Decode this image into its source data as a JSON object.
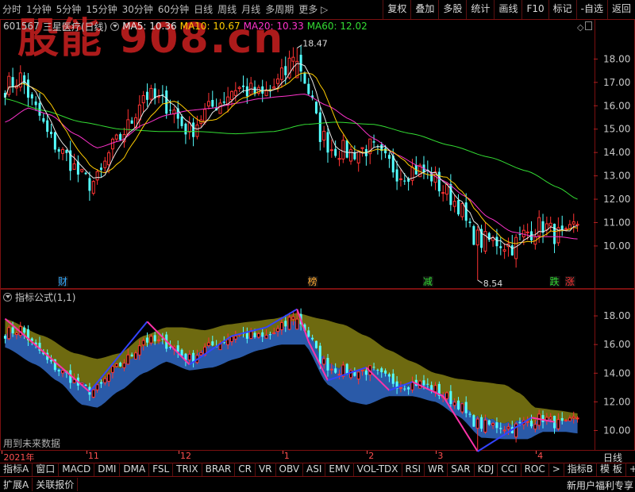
{
  "toolbar": {
    "periods": [
      "分时",
      "1分钟",
      "5分钟",
      "15分钟",
      "30分钟",
      "60分钟",
      "日线",
      "周线",
      "月线",
      "多周期",
      "更多 ▷"
    ],
    "tools": [
      "复权",
      "叠加",
      "多股",
      "统计",
      "画线",
      "F10",
      "标记",
      "-自选",
      "返回"
    ]
  },
  "stock": {
    "code": "601567",
    "name": "三星医疗(日线)"
  },
  "ma_readout": {
    "ma5": "MA5: 10.36",
    "ma10": "MA10: 10.67",
    "ma20": "MA20: 10.33",
    "ma60": "MA60: 12.02"
  },
  "watermark": "股能 908.cn",
  "indicator": {
    "title": "指标公式(1,1)",
    "future_note": "用到未来数据"
  },
  "date_axis": [
    {
      "label": "2021年",
      "index": 0
    },
    {
      "label": "11",
      "index": 22
    },
    {
      "label": "12",
      "index": 46
    },
    {
      "label": "1",
      "index": 73
    },
    {
      "label": "2",
      "index": 95
    },
    {
      "label": "3",
      "index": 113
    },
    {
      "label": "4",
      "index": 139
    }
  ],
  "zoom_label": "日线",
  "indicator_tabs": [
    "指标A",
    "窗口",
    "MACD",
    "DMI",
    "DMA",
    "FSL",
    "TRIX",
    "BRAR",
    "CR",
    "VR",
    "OBV",
    "ASI",
    "EMV",
    "VOL-TDX",
    "RSI",
    "WR",
    "SAR",
    "KDJ",
    "CCI",
    "ROC",
    ">",
    "指标B",
    "模 板",
    "+",
    "-"
  ],
  "bottom": {
    "left": [
      "扩展A",
      "关联报价"
    ],
    "promo": "新用户福利专享"
  },
  "colors": {
    "up": "#ff3333",
    "down": "#54ffff",
    "frame": "#7a1010",
    "ma5": "#e8e8e8",
    "ma10": "#ffcc00",
    "ma20": "#ff33cc",
    "ma60": "#33dd33",
    "band_upper": "#6e6a10",
    "band_lower": "#2a5aa8"
  },
  "chart_data": [
    {
      "type": "candlestick",
      "name": "main",
      "yticks": [
        10.0,
        11.0,
        12.0,
        13.0,
        14.0,
        15.0,
        16.0,
        17.0,
        18.0
      ],
      "ylim": [
        8.3,
        19.1
      ],
      "n_bars": 150,
      "ohlc_key": [
        [
          0,
          16.8
        ],
        [
          4,
          17.2
        ],
        [
          8,
          15.8
        ],
        [
          12,
          14.5
        ],
        [
          16,
          13.8
        ],
        [
          20,
          12.9
        ],
        [
          22,
          12.7
        ],
        [
          24,
          12.8
        ],
        [
          28,
          14.2
        ],
        [
          32,
          15.1
        ],
        [
          36,
          16.5
        ],
        [
          40,
          16.2
        ],
        [
          43,
          16.0
        ],
        [
          46,
          15.2
        ],
        [
          48,
          14.9
        ],
        [
          52,
          15.7
        ],
        [
          56,
          16.2
        ],
        [
          60,
          16.8
        ],
        [
          64,
          16.6
        ],
        [
          67,
          16.4
        ],
        [
          70,
          16.8
        ],
        [
          73,
          17.4
        ],
        [
          75,
          18.3
        ],
        [
          77,
          17.6
        ],
        [
          79,
          16.6
        ],
        [
          82,
          14.8
        ],
        [
          85,
          14.2
        ],
        [
          90,
          14.0
        ],
        [
          95,
          14.2
        ],
        [
          99,
          13.6
        ],
        [
          103,
          13.1
        ],
        [
          107,
          13.3
        ],
        [
          111,
          13.0
        ],
        [
          114,
          12.4
        ],
        [
          118,
          11.8
        ],
        [
          121,
          10.6
        ],
        [
          124,
          10.2
        ],
        [
          128,
          10.2
        ],
        [
          132,
          10.0
        ],
        [
          136,
          10.6
        ],
        [
          140,
          10.9
        ],
        [
          143,
          10.5
        ],
        [
          146,
          10.3
        ],
        [
          149,
          11.0
        ]
      ],
      "ma20_key": [
        [
          0,
          15.3
        ],
        [
          6,
          15.9
        ],
        [
          12,
          15.6
        ],
        [
          18,
          14.8
        ],
        [
          24,
          14.2
        ],
        [
          30,
          14.5
        ],
        [
          36,
          15.2
        ],
        [
          42,
          15.6
        ],
        [
          48,
          15.8
        ],
        [
          54,
          15.9
        ],
        [
          60,
          16.1
        ],
        [
          66,
          16.3
        ],
        [
          72,
          16.4
        ],
        [
          78,
          16.5
        ],
        [
          84,
          16.0
        ],
        [
          90,
          15.4
        ],
        [
          96,
          14.6
        ],
        [
          102,
          13.9
        ],
        [
          108,
          13.4
        ],
        [
          114,
          12.8
        ],
        [
          120,
          12.1
        ],
        [
          126,
          11.2
        ],
        [
          132,
          10.6
        ],
        [
          138,
          10.4
        ],
        [
          144,
          10.4
        ],
        [
          149,
          10.3
        ]
      ],
      "ma60_key": [
        [
          0,
          16.3
        ],
        [
          10,
          15.8
        ],
        [
          20,
          15.3
        ],
        [
          30,
          15.0
        ],
        [
          40,
          14.9
        ],
        [
          50,
          14.9
        ],
        [
          60,
          14.8
        ],
        [
          70,
          14.9
        ],
        [
          78,
          15.2
        ],
        [
          86,
          15.3
        ],
        [
          96,
          15.2
        ],
        [
          106,
          14.8
        ],
        [
          116,
          14.3
        ],
        [
          126,
          13.8
        ],
        [
          136,
          13.2
        ],
        [
          144,
          12.5
        ],
        [
          149,
          12.0
        ]
      ],
      "annotations": [
        {
          "text": "18.47",
          "index": 76,
          "value": 18.47
        },
        {
          "text": "8.54",
          "index": 123,
          "value": 8.54
        }
      ],
      "event_markers": [
        {
          "text": "财",
          "index": 15,
          "color": "#33aaff"
        },
        {
          "text": "榜",
          "index": 80,
          "color": "#ffaa33"
        },
        {
          "text": "减",
          "index": 110,
          "color": "#33dd33"
        },
        {
          "text": "跌",
          "index": 143,
          "color": "#33dd33"
        },
        {
          "text": "涨",
          "index": 147,
          "color": "#ff3333"
        }
      ]
    },
    {
      "type": "band_candlestick",
      "name": "indicator",
      "yticks": [
        10.0,
        12.0,
        14.0,
        16.0,
        18.0
      ],
      "ylim": [
        8.7,
        19.0
      ],
      "upper_key": [
        [
          0,
          17.8
        ],
        [
          10,
          16.6
        ],
        [
          18,
          15.4
        ],
        [
          24,
          15.0
        ],
        [
          30,
          15.4
        ],
        [
          36,
          16.6
        ],
        [
          42,
          17.2
        ],
        [
          46,
          17.2
        ],
        [
          52,
          17.0
        ],
        [
          58,
          17.4
        ],
        [
          64,
          17.6
        ],
        [
          70,
          17.8
        ],
        [
          76,
          18.2
        ],
        [
          82,
          17.8
        ],
        [
          88,
          17.4
        ],
        [
          94,
          16.6
        ],
        [
          100,
          15.6
        ],
        [
          106,
          14.8
        ],
        [
          112,
          14.0
        ],
        [
          118,
          13.6
        ],
        [
          124,
          13.4
        ],
        [
          130,
          13.2
        ],
        [
          134,
          12.6
        ],
        [
          138,
          11.6
        ],
        [
          144,
          11.4
        ],
        [
          149,
          11.2
        ]
      ],
      "lower_key": [
        [
          0,
          15.8
        ],
        [
          8,
          14.6
        ],
        [
          14,
          13.4
        ],
        [
          20,
          11.8
        ],
        [
          24,
          11.6
        ],
        [
          30,
          12.8
        ],
        [
          36,
          14.0
        ],
        [
          42,
          14.8
        ],
        [
          48,
          14.2
        ],
        [
          54,
          14.4
        ],
        [
          60,
          15.0
        ],
        [
          66,
          15.6
        ],
        [
          72,
          16.0
        ],
        [
          78,
          16.0
        ],
        [
          84,
          13.2
        ],
        [
          90,
          12.0
        ],
        [
          94,
          11.8
        ],
        [
          100,
          12.4
        ],
        [
          106,
          12.4
        ],
        [
          112,
          12.0
        ],
        [
          118,
          11.0
        ],
        [
          124,
          9.5
        ],
        [
          130,
          9.4
        ],
        [
          136,
          9.4
        ],
        [
          140,
          9.9
        ],
        [
          146,
          9.9
        ],
        [
          149,
          9.8
        ]
      ],
      "zigzag": [
        [
          0,
          17.8
        ],
        [
          22,
          12.7
        ],
        [
          37,
          17.6
        ],
        [
          48,
          14.6
        ],
        [
          59,
          16.6
        ],
        [
          68,
          17.2
        ],
        [
          76,
          18.47
        ],
        [
          79,
          16.2
        ],
        [
          84,
          13.5
        ],
        [
          94,
          14.4
        ],
        [
          100,
          12.8
        ],
        [
          106,
          13.4
        ],
        [
          114,
          12.4
        ],
        [
          123,
          8.54
        ],
        [
          137,
          10.9
        ],
        [
          143,
          10.6
        ]
      ]
    }
  ]
}
